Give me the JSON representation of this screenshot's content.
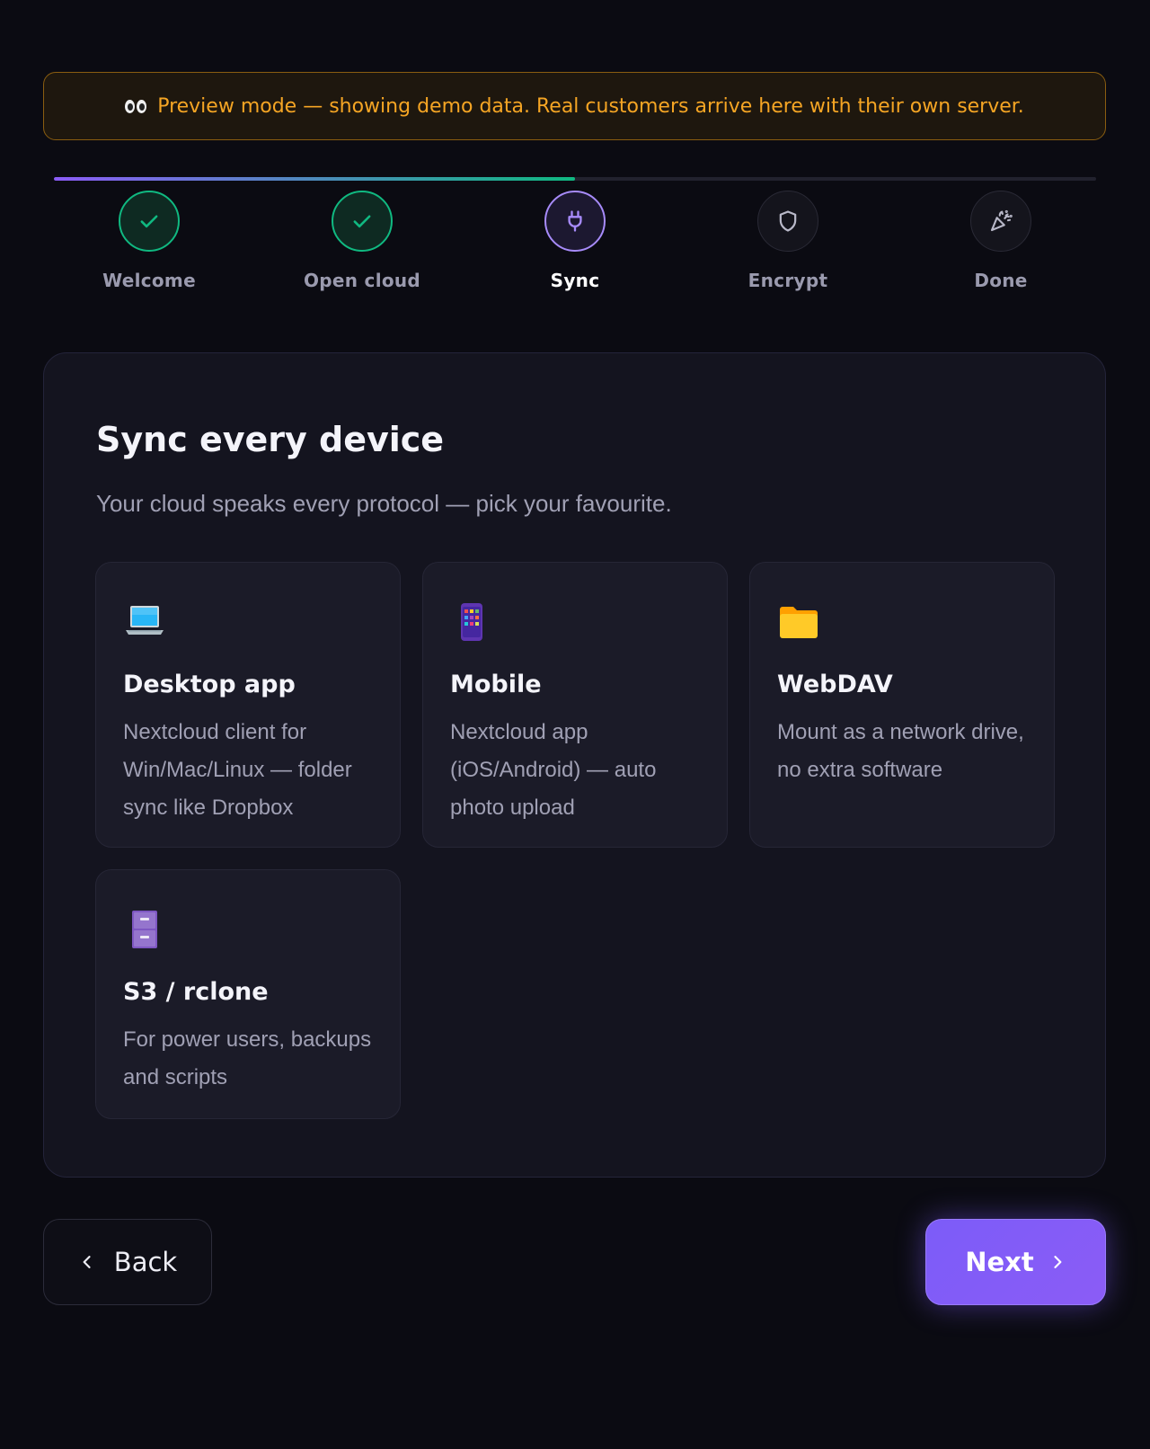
{
  "banner": {
    "icon": "eyes-emoji",
    "text": "Preview mode — showing demo data. Real customers arrive here with their own server."
  },
  "progress": {
    "completed_fraction": 0.5
  },
  "steps": [
    {
      "label": "Welcome",
      "state": "done",
      "icon": "check-icon"
    },
    {
      "label": "Open cloud",
      "state": "done",
      "icon": "check-icon"
    },
    {
      "label": "Sync",
      "state": "active",
      "icon": "plug-icon"
    },
    {
      "label": "Encrypt",
      "state": "pending",
      "icon": "shield-icon"
    },
    {
      "label": "Done",
      "state": "pending",
      "icon": "party-popper-icon"
    }
  ],
  "panel": {
    "title": "Sync every device",
    "subtitle": "Your cloud speaks every protocol — pick your favourite.",
    "cards": [
      {
        "icon": "laptop-icon",
        "title": "Desktop app",
        "description": "Nextcloud client for Win/Mac/Linux — folder sync like Dropbox"
      },
      {
        "icon": "mobile-phone-icon",
        "title": "Mobile",
        "description": "Nextcloud app (iOS/Android) — auto photo upload"
      },
      {
        "icon": "folder-icon",
        "title": "WebDAV",
        "description": "Mount as a network drive, no extra software"
      },
      {
        "icon": "file-cabinet-icon",
        "title": "S3 / rclone",
        "description": "For power users, backups and scripts"
      }
    ]
  },
  "nav": {
    "back_label": "Back",
    "next_label": "Next"
  },
  "colors": {
    "accent": "#8b5cf6",
    "success": "#10b981",
    "warning": "#f5a524",
    "background": "#0b0b12"
  }
}
